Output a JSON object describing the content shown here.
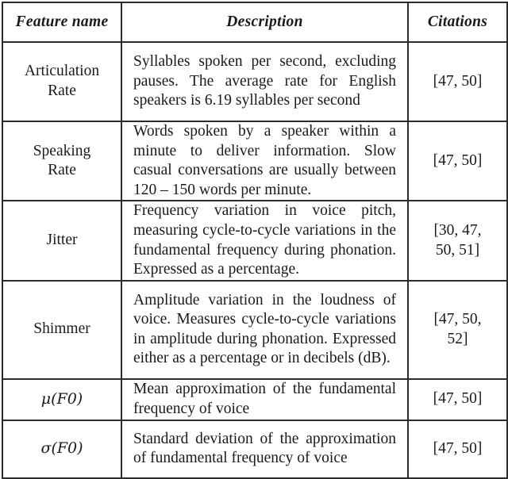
{
  "table": {
    "headers": {
      "feature": "Feature name",
      "description": "Description",
      "citations": "Citations"
    },
    "rows": [
      {
        "feature": "Articulation Rate",
        "description": "Syllables spoken per second, excluding pauses. The average rate for English speakers is 6.19 syllables per second",
        "citations": "[47, 50]"
      },
      {
        "feature": "Speaking Rate",
        "description": "Words spoken by a speaker within a minute to deliver information. Slow casual conversations are usually between 120 – 150 words per minute.",
        "citations": "[47, 50]"
      },
      {
        "feature": "Jitter",
        "description": "Frequency variation in voice pitch, measuring cycle-to-cycle variations in the fundamental frequency during phonation. Expressed as a percentage.",
        "citations": "[30, 47, 50, 51]"
      },
      {
        "feature": "Shimmer",
        "description": "Amplitude variation in the loudness of voice. Measures cycle-to-cycle variations in amplitude during phonation. Expressed either as a percentage or in decibels (dB).",
        "citations": "[47, 50, 52]"
      },
      {
        "feature": "μ(F0)",
        "feature_symbol": "μ",
        "feature_arg": "(F0)",
        "description": "Mean approximation of the fundamental frequency of voice",
        "citations": "[47, 50]"
      },
      {
        "feature": "σ(F0)",
        "feature_symbol": "σ",
        "feature_arg": "(F0)",
        "description": "Standard deviation of the approximation of fundamental frequency of voice",
        "citations": "[47, 50]"
      }
    ]
  }
}
